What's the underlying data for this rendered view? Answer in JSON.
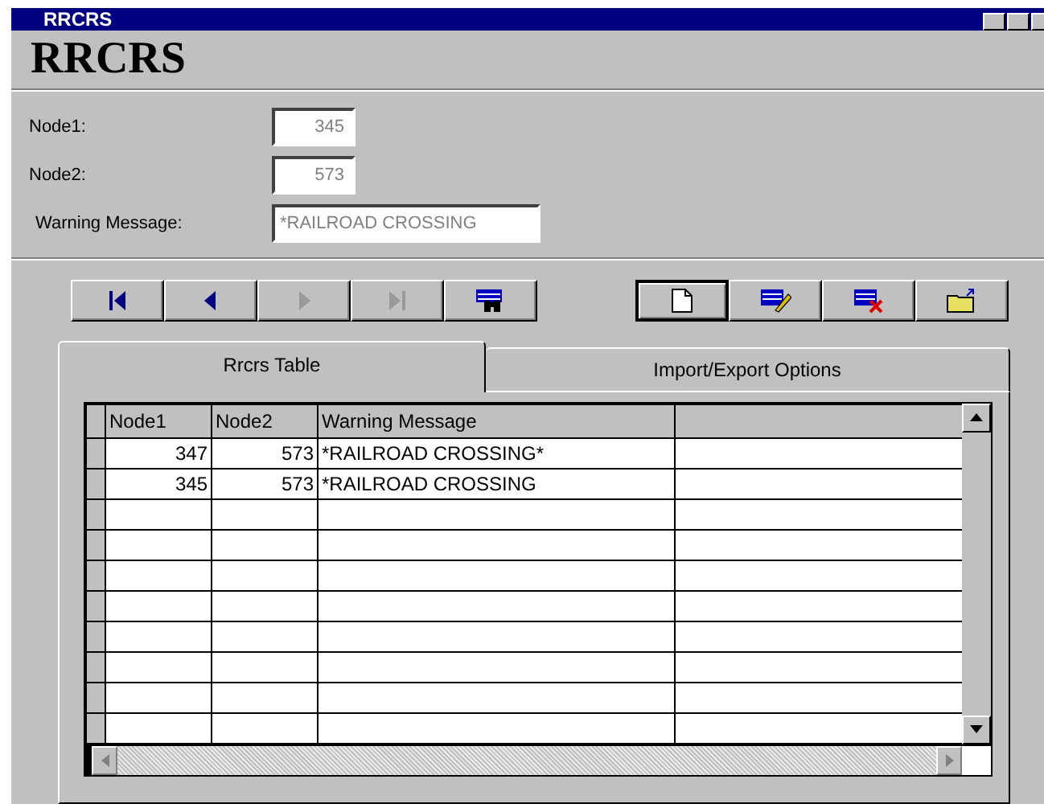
{
  "window": {
    "title": "RRCRS"
  },
  "heading": "RRCRS",
  "fields": [
    {
      "label": "Node1:",
      "value": "345",
      "disabled": true
    },
    {
      "label": "Node2:",
      "value": "573",
      "disabled": true
    },
    {
      "label": "Warning Message:",
      "value": "*RAILROAD CROSSING",
      "disabled": true
    }
  ],
  "toolbar": [
    {
      "kind": "first",
      "disabled": false
    },
    {
      "kind": "prev",
      "disabled": false
    },
    {
      "kind": "next",
      "disabled": true
    },
    {
      "kind": "last",
      "disabled": true
    },
    {
      "kind": "find",
      "disabled": false
    },
    {
      "kind": "new",
      "disabled": false
    },
    {
      "kind": "edit",
      "disabled": false
    },
    {
      "kind": "delete",
      "disabled": false
    },
    {
      "kind": "export",
      "disabled": false
    }
  ],
  "tabs": [
    {
      "label": "Rrcrs Table",
      "selected": true
    },
    {
      "label": "Import/Export Options",
      "selected": false
    }
  ],
  "table": {
    "columns": [
      "Node1",
      "Node2",
      "Warning Message"
    ],
    "rows": [
      [
        "347",
        "573",
        "*RAILROAD CROSSING*"
      ],
      [
        "345",
        "573",
        "*RAILROAD CROSSING"
      ]
    ]
  }
}
